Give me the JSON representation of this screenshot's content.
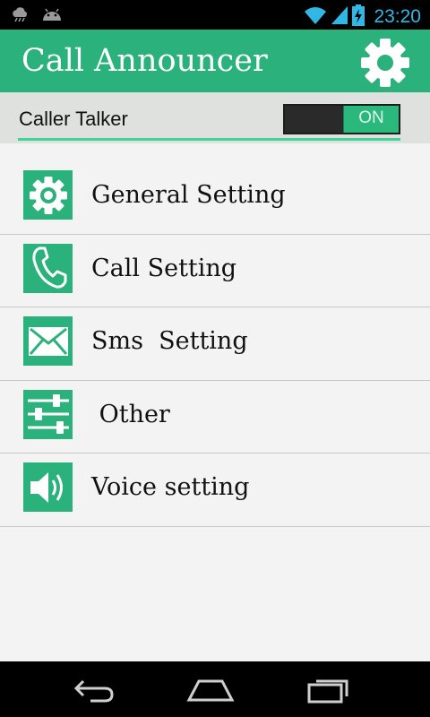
{
  "status_bar": {
    "time": "23:20",
    "icons": [
      "weather-icon",
      "android-icon",
      "wifi-icon",
      "signal-icon",
      "battery-charging-icon"
    ]
  },
  "app_bar": {
    "title": "Call Announcer",
    "settings_icon": "gear-icon"
  },
  "toggle": {
    "label": "Caller Talker",
    "state": "ON"
  },
  "menu": [
    {
      "label": "General Setting",
      "icon": "gear-icon"
    },
    {
      "label": "Call Setting",
      "icon": "phone-icon"
    },
    {
      "label": "Sms  Setting",
      "icon": "envelope-icon"
    },
    {
      "label": " Other",
      "icon": "sliders-icon"
    },
    {
      "label": "Voice setting",
      "icon": "speaker-icon"
    }
  ],
  "nav_bar": {
    "icons": [
      "back-icon",
      "home-icon",
      "recent-apps-icon"
    ]
  },
  "colors": {
    "accent": "#2bb17c",
    "toggle_underline": "#3fd39a",
    "clock": "#2fb8e6"
  }
}
